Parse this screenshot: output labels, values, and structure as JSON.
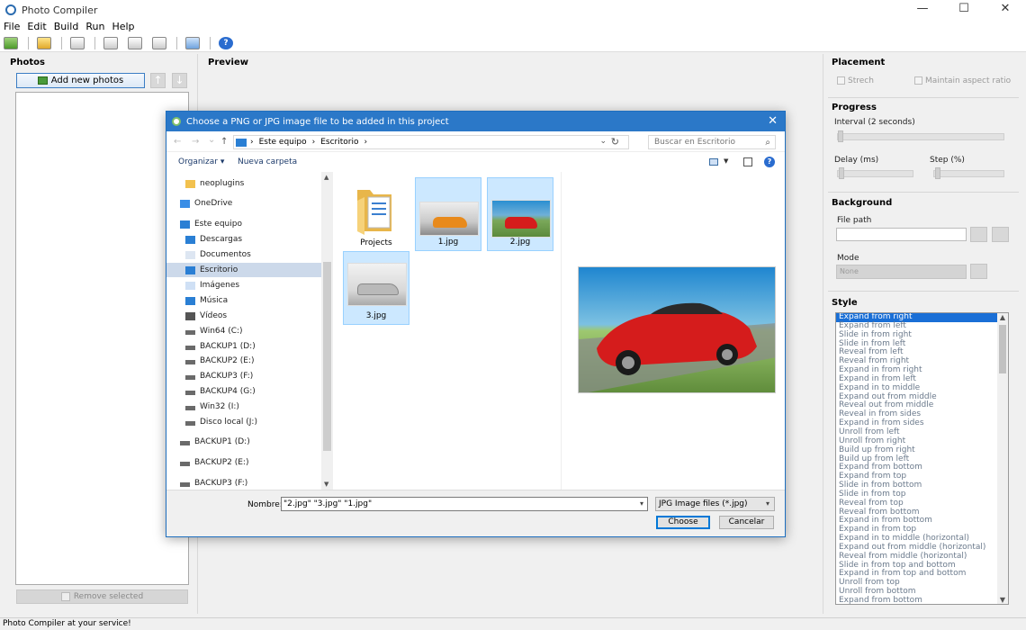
{
  "window": {
    "title": "Photo Compiler",
    "minimize": "—",
    "maximize": "☐",
    "close": "✕"
  },
  "menu": [
    "File",
    "Edit",
    "Build",
    "Run",
    "Help"
  ],
  "toolbar": {
    "help": "?"
  },
  "photos": {
    "title": "Photos",
    "add_label": "Add new photos",
    "up": "↑",
    "down": "↓",
    "remove_label": "Remove selected"
  },
  "preview": {
    "title": "Preview"
  },
  "placement": {
    "title": "Placement",
    "stretch": "Strech",
    "aspect": "Maintain aspect ratio"
  },
  "progress": {
    "title": "Progress",
    "interval": "Interval (2 seconds)",
    "delay": "Delay (ms)",
    "step": "Step (%)"
  },
  "background": {
    "title": "Background",
    "file_path": "File path",
    "mode": "Mode",
    "mode_value": "None"
  },
  "style": {
    "title": "Style",
    "items": [
      "Expand from right",
      "Expand from left",
      "Slide in from right",
      "Slide in from left",
      "Reveal from left",
      "Reveal from right",
      "Expand in from right",
      "Expand in from left",
      "Expand in to middle",
      "Expand out from middle",
      "Reveal out from middle",
      "Reveal in from sides",
      "Expand in from sides",
      "Unroll from left",
      "Unroll from right",
      "Build up from right",
      "Build up from left",
      "Expand from bottom",
      "Expand from top",
      "Slide in from bottom",
      "Slide in from top",
      "Reveal from top",
      "Reveal from bottom",
      "Expand in from bottom",
      "Expand in from top",
      "Expand in to middle (horizontal)",
      "Expand out from middle (horizontal)",
      "Reveal from middle (horizontal)",
      "Slide in from top and bottom",
      "Expand in from top and bottom",
      "Unroll from top",
      "Unroll from bottom",
      "Expand from bottom"
    ],
    "selected_index": 0
  },
  "status": "Photo Compiler at your service!",
  "dialog": {
    "title": "Choose a PNG or JPG image file to be added in this project",
    "close": "✕",
    "nav": {
      "back": "←",
      "forward": "→",
      "recent": "⌄",
      "up": "↑"
    },
    "breadcrumb": [
      "Este equipo",
      "Escritorio"
    ],
    "breadcrumb_sep": "›",
    "search_placeholder": "Buscar en Escritorio",
    "organize": "Organizar ▾",
    "new_folder": "Nueva carpeta",
    "view_dd": "▼",
    "help": "?",
    "nav_items": [
      {
        "label": "neoplugins",
        "icon": "folder-icon"
      },
      {
        "label": "OneDrive",
        "icon": "cloud-icon"
      },
      {
        "label": "Este equipo",
        "icon": "computer-icon"
      },
      {
        "label": "Descargas",
        "icon": "download-icon"
      },
      {
        "label": "Documentos",
        "icon": "documents-icon"
      },
      {
        "label": "Escritorio",
        "icon": "desktop-icon"
      },
      {
        "label": "Imágenes",
        "icon": "pictures-icon"
      },
      {
        "label": "Música",
        "icon": "music-icon"
      },
      {
        "label": "Vídeos",
        "icon": "videos-icon"
      },
      {
        "label": "Win64 (C:)",
        "icon": "drive-icon"
      },
      {
        "label": "BACKUP1 (D:)",
        "icon": "drive-icon"
      },
      {
        "label": "BACKUP2 (E:)",
        "icon": "drive-icon"
      },
      {
        "label": "BACKUP3 (F:)",
        "icon": "drive-icon"
      },
      {
        "label": "BACKUP4 (G:)",
        "icon": "drive-icon"
      },
      {
        "label": "Win32 (I:)",
        "icon": "drive-icon"
      },
      {
        "label": "Disco local (J:)",
        "icon": "drive-icon"
      },
      {
        "label": "BACKUP1 (D:)",
        "icon": "drive-icon"
      },
      {
        "label": "BACKUP2 (E:)",
        "icon": "drive-icon"
      },
      {
        "label": "BACKUP3 (F:)",
        "icon": "drive-icon"
      }
    ],
    "files": [
      "Projects",
      "1.jpg",
      "2.jpg",
      "3.jpg"
    ],
    "name_label": "Nombre:",
    "name_value": "\"2.jpg\" \"3.jpg\" \"1.jpg\"",
    "type_value": "JPG Image files (*.jpg)",
    "choose": "Choose",
    "cancel": "Cancelar"
  }
}
